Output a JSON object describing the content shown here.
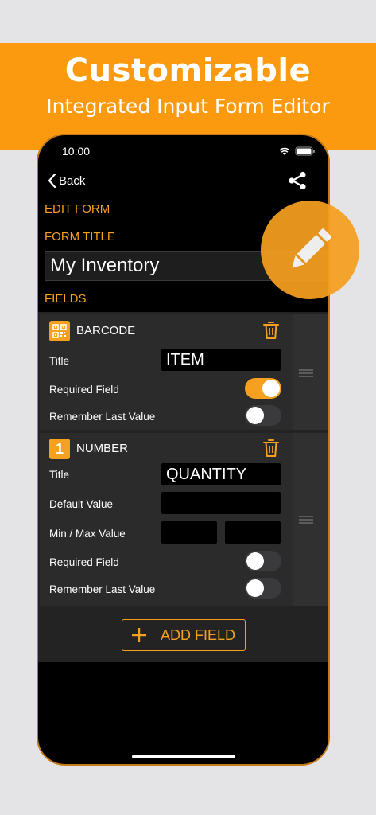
{
  "banner": {
    "title": "Customizable",
    "subtitle": "Integrated Input Form Editor"
  },
  "status_bar": {
    "time": "10:00"
  },
  "nav": {
    "back_label": "Back"
  },
  "labels": {
    "edit_form": "EDIT FORM",
    "form_title": "FORM TITLE",
    "fields": "FIELDS"
  },
  "form_title_value": "My Inventory",
  "fields": [
    {
      "type_label": "BARCODE",
      "title_label": "Title",
      "title_value": "ITEM",
      "required_label": "Required Field",
      "required": true,
      "remember_label": "Remember Last Value",
      "remember": false
    },
    {
      "badge": "1",
      "type_label": "NUMBER",
      "title_label": "Title",
      "title_value": "QUANTITY",
      "default_label": "Default Value",
      "default_value": "",
      "minmax_label": "Min / Max Value",
      "min_value": "",
      "max_value": "",
      "required_label": "Required Field",
      "required": false,
      "remember_label": "Remember Last Value",
      "remember": false
    }
  ],
  "add_field_label": "ADD FIELD",
  "colors": {
    "accent": "#f6a020",
    "banner": "#fb9a0f",
    "background": "#000000"
  },
  "icons": [
    "back-chevron-icon",
    "share-icon",
    "barcode-icon",
    "trash-icon",
    "drag-handle-icon",
    "plus-icon",
    "pencil-icon",
    "wifi-icon",
    "battery-icon"
  ]
}
